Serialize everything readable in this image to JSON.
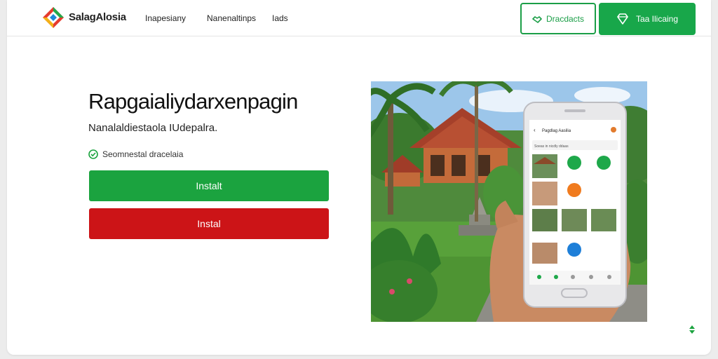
{
  "header": {
    "brand": "SalagAlosia",
    "nav": [
      "Inapesiany",
      "Nanenaltinps",
      "Iads"
    ],
    "outline_button": "Dracdacts",
    "solid_button": "Taa Ilicaing"
  },
  "hero": {
    "title": "Rapgaialiydarxenpagin",
    "subtitle": "Nanalaldiestaola IUdepalra.",
    "check_text": "Seomnestal dracelaia",
    "primary_button": "Instalt",
    "secondary_button": "Instal"
  },
  "phone": {
    "app_title": "Pagdlag Aasilia",
    "search_text": "Soeas in nicdly ddaas"
  },
  "colors": {
    "accent_green": "#18a74a",
    "danger_red": "#cc1417",
    "outline_green": "#1b9e47"
  },
  "icons": {
    "logo": "colored-diamond-logo",
    "outline_button_icon": "handshake-icon",
    "solid_button_icon": "diamond-icon",
    "check": "check-circle-icon",
    "scroll": "scroll-arrows-icon"
  }
}
